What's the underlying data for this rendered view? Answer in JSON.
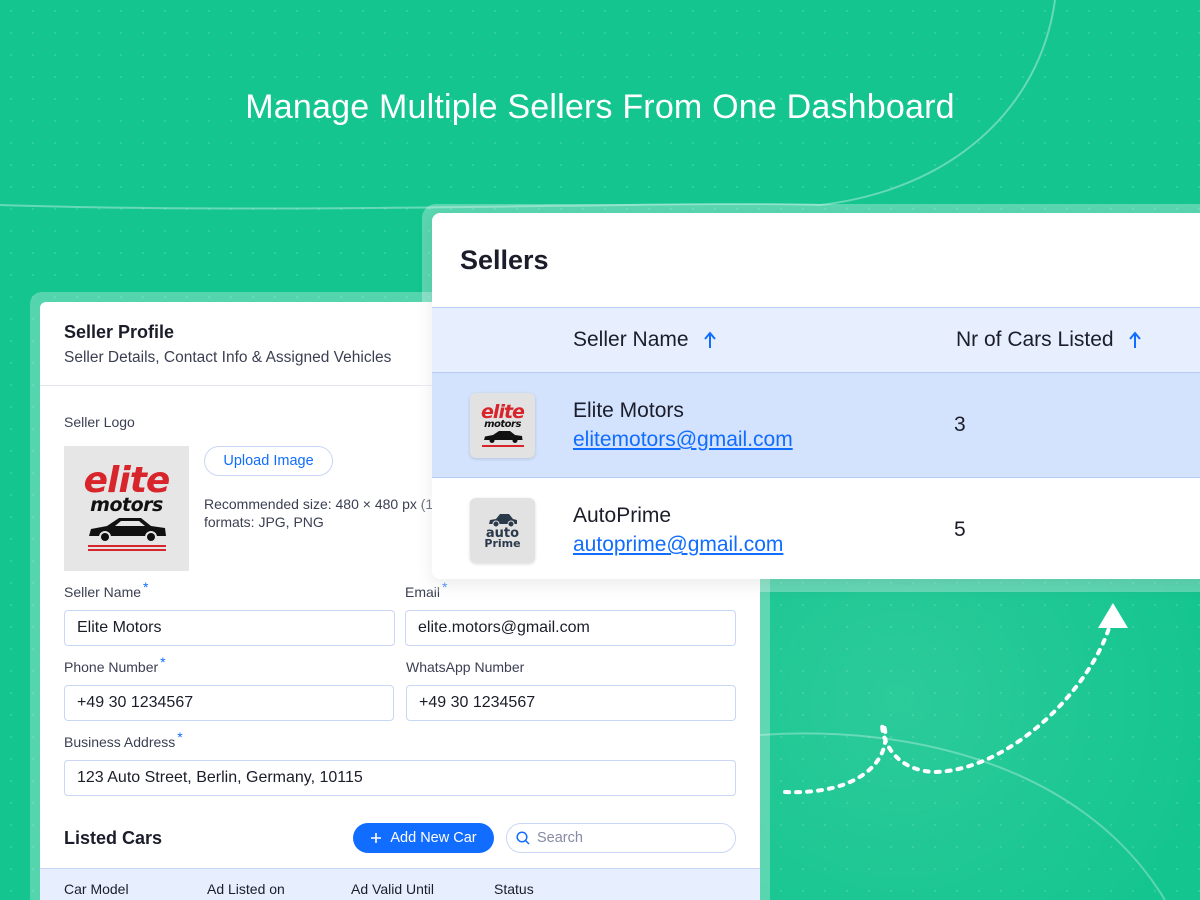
{
  "headline": "Manage Multiple Sellers From One Dashboard",
  "colors": {
    "background": "#14c58f",
    "accent": "#116dff",
    "row_selected": "#d3e2fd",
    "header_row": "#e7efff"
  },
  "profile": {
    "title": "Seller Profile",
    "subtitle": "Seller Details, Contact Info & Assigned Vehicles",
    "logo_label": "Seller Logo",
    "logo": {
      "word1": "elite",
      "word2": "motors",
      "icon": "car-icon"
    },
    "upload_label": "Upload Image",
    "recommendation": "Recommended size: 480 × 480 px (1",
    "formats": "formats: JPG, PNG",
    "required_mark": "*",
    "fields": {
      "seller_name": {
        "label": "Seller Name",
        "value": "Elite Motors"
      },
      "email": {
        "label": "Email",
        "value": "elite.motors@gmail.com"
      },
      "phone": {
        "label": "Phone Number",
        "value": "+49 30 1234567"
      },
      "whatsapp": {
        "label": "WhatsApp Number",
        "value": "+49 30 1234567"
      },
      "address": {
        "label": "Business Address",
        "value": "123 Auto Street, Berlin, Germany, 10115"
      }
    },
    "listed_cars": {
      "title": "Listed Cars",
      "add_label": "Add New Car",
      "search_placeholder": "Search",
      "columns": [
        "Car Model",
        "Ad Listed on",
        "Ad Valid Until",
        "Status"
      ]
    }
  },
  "sellers": {
    "title": "Sellers",
    "columns": {
      "name": "Seller Name",
      "count": "Nr of Cars Listed"
    },
    "rows": [
      {
        "name": "Elite Motors",
        "email": "elitemotors@gmail.com",
        "count": "3",
        "selected": true,
        "logo": {
          "word1": "elite",
          "word2": "motors"
        }
      },
      {
        "name": "AutoPrime",
        "email": "autoprime@gmail.com",
        "count": "5",
        "selected": false,
        "logo": {
          "word1": "auto",
          "word2": "Prime"
        }
      }
    ]
  }
}
